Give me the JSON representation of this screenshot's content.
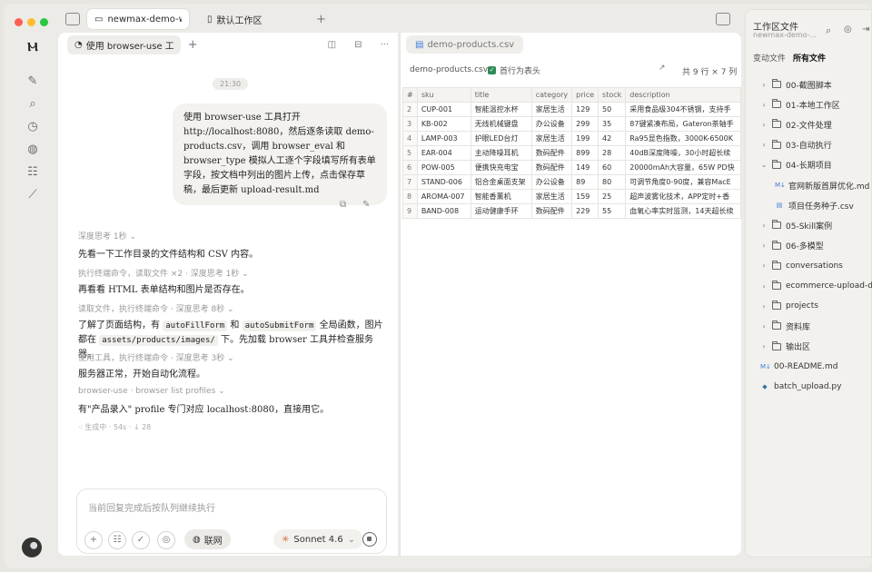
{
  "tabs": [
    {
      "label": "newmax-demo-work",
      "active": true
    },
    {
      "label": "默认工作区",
      "active": false
    }
  ],
  "chat": {
    "tab_label": "使用 browser-use 工具打开",
    "time": "21:30",
    "user_message": "使用 browser-use 工具打开 http://localhost:8080，然后逐条读取 demo-products.csv，调用 browser_eval 和 browser_type 模拟人工逐个字段填写所有表单字段，按文档中列出的图片上传，点击保存草稿，最后更新 upload-result.md",
    "steps": [
      {
        "meta": "深度思考 1秒",
        "text": "先看一下工作目录的文件结构和 CSV 内容。"
      },
      {
        "meta": "执行终端命令，读取文件 ×2 · 深度思考 1秒",
        "text": "再看看 HTML 表单结构和图片是否存在。"
      },
      {
        "meta": "读取文件，执行终端命令 · 深度思考 8秒",
        "text_a": "了解了页面结构，有",
        "code1": "autoFillForm",
        "text_b": "和",
        "code2": "autoSubmitForm",
        "text_c": "全局函数，图片都在",
        "code3": "assets/products/images/",
        "text_d": "下。先加载 browser 工具并检查服务器。"
      },
      {
        "meta": "使用工具，执行终端命令 · 深度思考 3秒",
        "text": "服务器正常，开始自动化流程。"
      },
      {
        "meta": "browser-use · browser list profiles",
        "text": "有\"产品录入\" profile 专门对应 localhost:8080，直接用它。"
      }
    ],
    "generating": "生成中 · 54s · ↓ 28",
    "composer_placeholder": "当前回复完成后按队列继续执行",
    "net_label": "联网",
    "model_label": "Sonnet 4.6"
  },
  "csv": {
    "tab_label": "demo-products.csv",
    "file_name": "demo-products.csv",
    "header_row_label": "首行为表头",
    "row_count": "共 9 行 × 7 列",
    "columns": [
      "#",
      "sku",
      "title",
      "category",
      "price",
      "stock",
      "description"
    ],
    "rows": [
      [
        "2",
        "CUP-001",
        "智能温控水杯",
        "家居生活",
        "129",
        "50",
        "采用食品级304不锈钢，支持手"
      ],
      [
        "3",
        "KB-002",
        "无线机械键盘",
        "办公设备",
        "299",
        "35",
        "87键紧凑布局，Gateron茶轴手"
      ],
      [
        "4",
        "LAMP-003",
        "护眼LED台灯",
        "家居生活",
        "199",
        "42",
        "Ra95显色指数，3000K-6500K"
      ],
      [
        "5",
        "EAR-004",
        "主动降噪耳机",
        "数码配件",
        "899",
        "28",
        "40dB深度降噪，30小时超长续"
      ],
      [
        "6",
        "POW-005",
        "便携快充电宝",
        "数码配件",
        "149",
        "60",
        "20000mAh大容量，65W PD快"
      ],
      [
        "7",
        "STAND-006",
        "铝合金桌面支架",
        "办公设备",
        "89",
        "80",
        "可调节角度0-90度，兼容MacE"
      ],
      [
        "8",
        "AROMA-007",
        "智能香薰机",
        "家居生活",
        "159",
        "25",
        "超声波雾化技术，APP定时+香"
      ],
      [
        "9",
        "BAND-008",
        "运动健康手环",
        "数码配件",
        "229",
        "55",
        "血氧心率实时监测，14天超长续"
      ]
    ]
  },
  "files": {
    "title": "工作区文件",
    "subtitle": "newmax-demo-...",
    "tab_changed": "变动文件",
    "tab_all": "所有文件",
    "tree": [
      {
        "name": "00-截图脚本",
        "kind": "folder",
        "open": false,
        "depth": 0
      },
      {
        "name": "01-本地工作区",
        "kind": "folder",
        "open": false,
        "depth": 0
      },
      {
        "name": "02-文件处理",
        "kind": "folder",
        "open": false,
        "depth": 0
      },
      {
        "name": "03-自动执行",
        "kind": "folder",
        "open": false,
        "depth": 0
      },
      {
        "name": "04-长期项目",
        "kind": "folder",
        "open": true,
        "depth": 0
      },
      {
        "name": "官网新版首屏优化.md",
        "kind": "md",
        "depth": 1
      },
      {
        "name": "项目任务种子.csv",
        "kind": "csv",
        "depth": 1
      },
      {
        "name": "05-Skill案例",
        "kind": "folder",
        "open": false,
        "depth": 0
      },
      {
        "name": "06-多模型",
        "kind": "folder",
        "open": false,
        "depth": 0
      },
      {
        "name": "conversations",
        "kind": "folder",
        "open": false,
        "depth": 0
      },
      {
        "name": "ecommerce-upload-der",
        "kind": "folder",
        "open": false,
        "depth": 0
      },
      {
        "name": "projects",
        "kind": "folder",
        "open": false,
        "depth": 0
      },
      {
        "name": "资料库",
        "kind": "folder",
        "open": false,
        "depth": 0
      },
      {
        "name": "输出区",
        "kind": "folder",
        "open": false,
        "depth": 0
      },
      {
        "name": "00-README.md",
        "kind": "md",
        "depth": 0
      },
      {
        "name": "batch_upload.py",
        "kind": "py",
        "depth": 0
      }
    ]
  },
  "colors": {
    "red": "#ff5f57",
    "yellow": "#febc2e",
    "green": "#28c840",
    "accent_check": "#2e8b57"
  }
}
